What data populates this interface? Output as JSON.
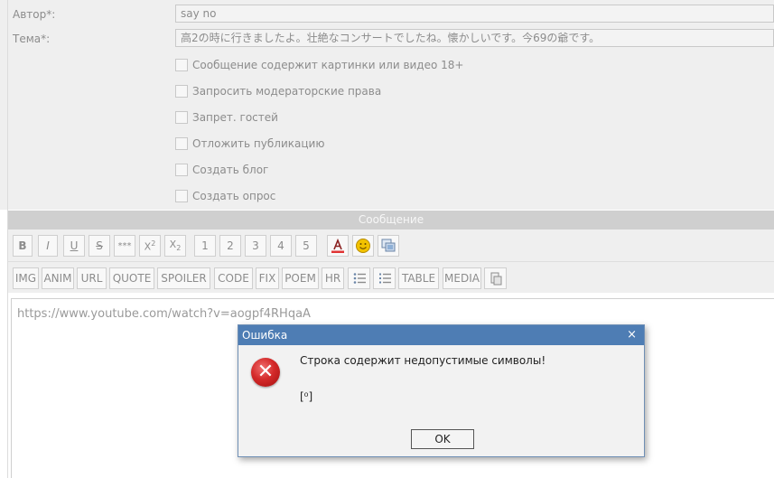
{
  "form": {
    "author_label": "Автор*:",
    "author_value": "say no",
    "subject_label": "Тема*:",
    "subject_value": "高2の時に行きましたよ。壮絶なコンサートでしたね。懐かしいです。今69の爺です。",
    "checkboxes": [
      {
        "label": "Сообщение содержит картинки или видео 18+",
        "checked": false
      },
      {
        "label": "Запросить модераторские права",
        "checked": false
      },
      {
        "label": "Запрет. гостей",
        "checked": false
      },
      {
        "label": "Отложить публикацию",
        "checked": false
      },
      {
        "label": "Создать блог",
        "checked": false
      },
      {
        "label": "Создать опрос",
        "checked": false
      }
    ]
  },
  "message_section": {
    "title": "Сообщение"
  },
  "toolbar_row1": {
    "buttons": [
      "B",
      "I",
      "U",
      "S",
      "***",
      "X2",
      "X2",
      "1",
      "2",
      "3",
      "4",
      "5"
    ],
    "icons": [
      "text-color-icon",
      "smiley-icon",
      "gallery-icon"
    ]
  },
  "toolbar_row2": {
    "buttons": [
      "IMG",
      "ANIM",
      "URL",
      "QUOTE",
      "SPOILER",
      "CODE",
      "FIX",
      "POEM",
      "HR",
      "TABLE",
      "MEDIA"
    ],
    "icons": [
      "bullet-list-icon",
      "numbered-list-icon",
      "mobile-icon"
    ]
  },
  "editor": {
    "content": "https://www.youtube.com/watch?v=aogpf4RHqaA"
  },
  "dialog": {
    "title": "Ошибка",
    "close": "×",
    "message": "Строка содержит недопустимые символы!",
    "code": "[⁰]",
    "ok": "OK",
    "icon": "error-icon"
  },
  "colors": {
    "dialog_title_bar": "#4e7db4",
    "section_bar": "#cfcfcf",
    "error_red": "#d42a2a"
  }
}
